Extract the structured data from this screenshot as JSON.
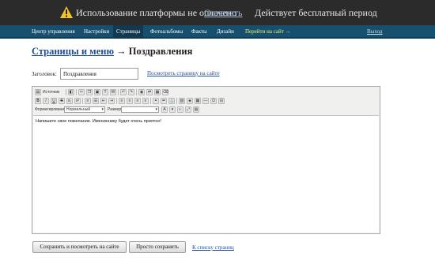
{
  "topbar": {
    "message": "Использование платформы не оплачено",
    "pay_link": "Оплатить",
    "trial_text": "Действует бесплатный период",
    "warning_icon": "warning-icon"
  },
  "nav": {
    "items": [
      {
        "label": "Центр управления",
        "active": false
      },
      {
        "label": "Настройки",
        "active": false
      },
      {
        "label": "Страницы",
        "active": true
      },
      {
        "label": "Фотоальбомы",
        "active": false
      },
      {
        "label": "Факты",
        "active": false
      },
      {
        "label": "Дизайн",
        "active": false
      }
    ],
    "goto_site": "Перейти на сайт →",
    "logout": "Выход",
    "colors": {
      "bar": "#16506e",
      "active": "#12394f",
      "goto_site": "#f2f27a"
    }
  },
  "page": {
    "breadcrumb_link": "Страницы и меню",
    "breadcrumb_arrow": "→",
    "title": "Поздравления"
  },
  "form": {
    "title_label": "Заголовок:",
    "title_value": "Поздравления",
    "view_link": "Посмотреть страницу на сайте"
  },
  "editor": {
    "source_label": "Источник",
    "format_label": "Форматирование",
    "format_value": "Нормальный",
    "size_label": "Размер",
    "size_value": "",
    "content": "Напишите свое пожелание. Имениннику будет очень приятно!"
  },
  "actions": {
    "save_view": "Сохранить и посмотреть на сайте",
    "save": "Просто сохранить",
    "back_to_list": "К списку страниц"
  }
}
